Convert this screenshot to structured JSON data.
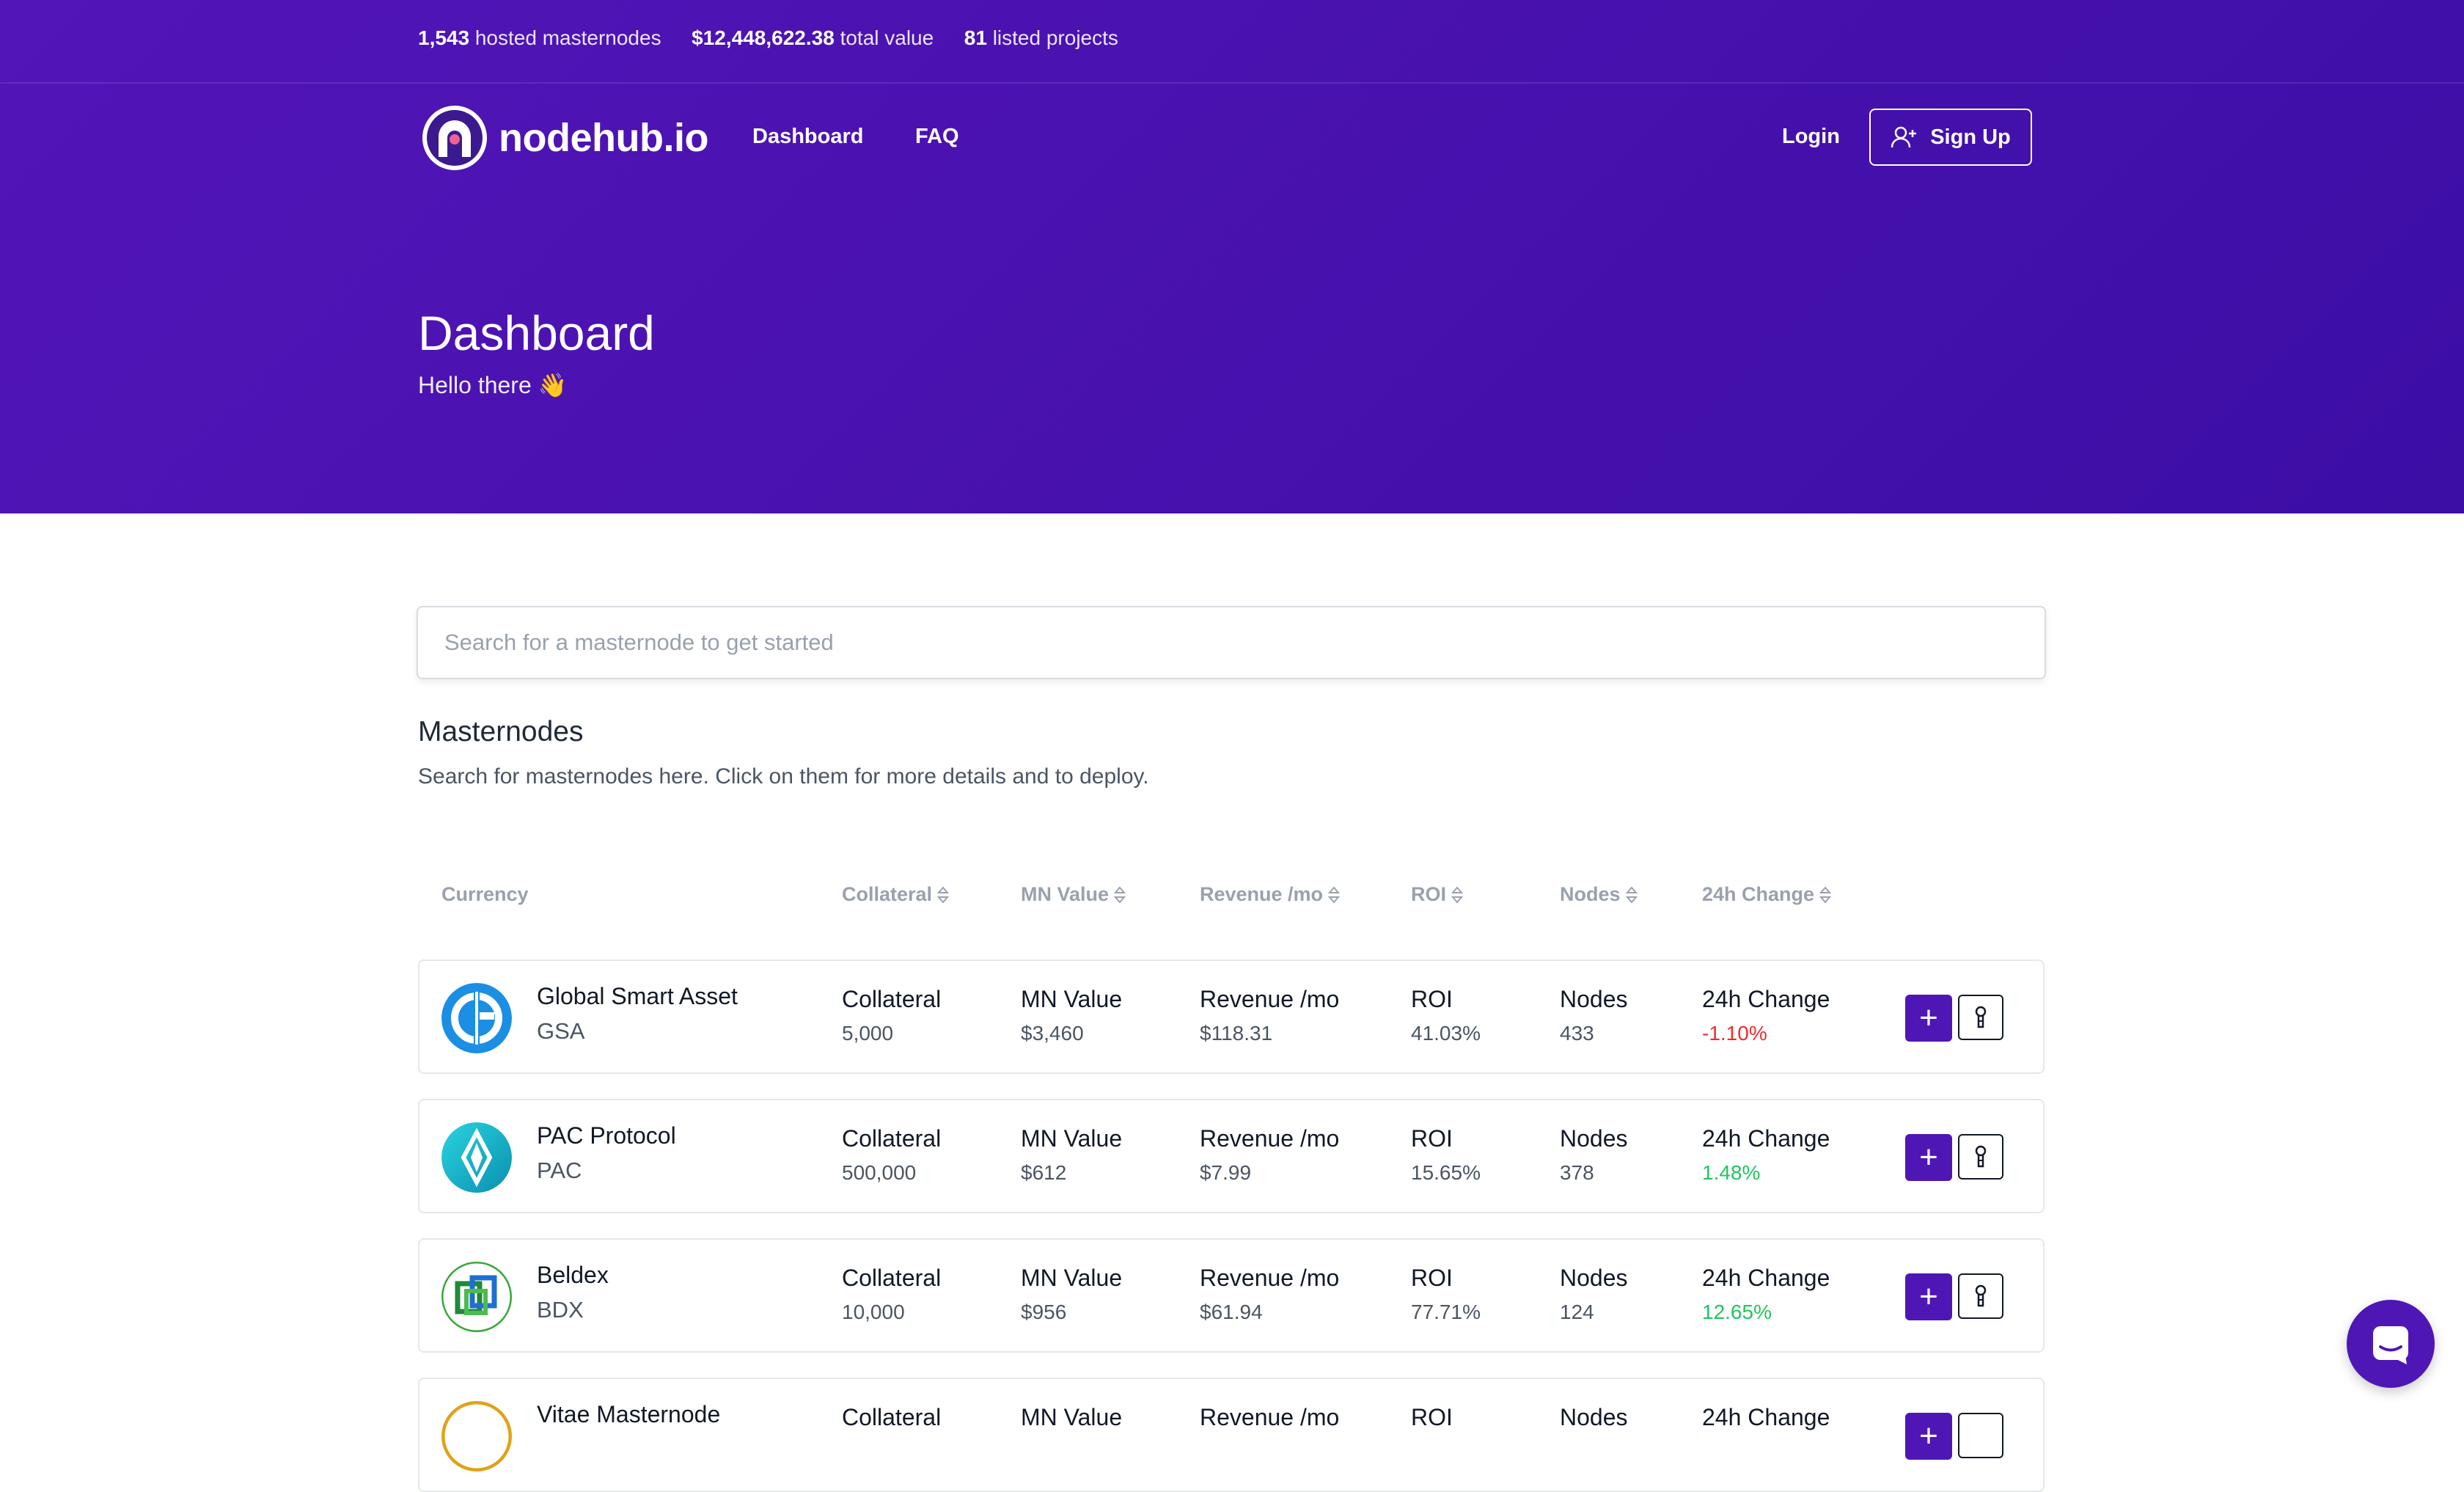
{
  "stats": {
    "masternodes_count": "1,543",
    "masternodes_label": "hosted masternodes",
    "total_value": "$12,448,622.38",
    "total_value_label": "total value",
    "projects_count": "81",
    "projects_label": "listed projects"
  },
  "nav": {
    "brand": "nodehub.io",
    "links": [
      "Dashboard",
      "FAQ"
    ],
    "login": "Login",
    "signup": "Sign Up"
  },
  "hero": {
    "title": "Dashboard",
    "subtitle": "Hello there 👋"
  },
  "search": {
    "placeholder": "Search for a masternode to get started"
  },
  "section": {
    "title": "Masternodes",
    "subtitle": "Search for masternodes here. Click on them for more details and to deploy."
  },
  "table": {
    "headers": [
      "Currency",
      "Collateral",
      "MN Value",
      "Revenue /mo",
      "ROI",
      "Nodes",
      "24h Change"
    ],
    "rows": [
      {
        "name": "Global Smart Asset",
        "symbol": "GSA",
        "collateral": "5,000",
        "mn_value": "$3,460",
        "revenue": "$118.31",
        "roi": "41.03%",
        "nodes": "433",
        "change": "-1.10%",
        "change_dir": "neg",
        "icon": "gsa-coin-icon"
      },
      {
        "name": "PAC Protocol",
        "symbol": "PAC",
        "collateral": "500,000",
        "mn_value": "$612",
        "revenue": "$7.99",
        "roi": "15.65%",
        "nodes": "378",
        "change": "1.48%",
        "change_dir": "pos",
        "icon": "pac-coin-icon"
      },
      {
        "name": "Beldex",
        "symbol": "BDX",
        "collateral": "10,000",
        "mn_value": "$956",
        "revenue": "$61.94",
        "roi": "77.71%",
        "nodes": "124",
        "change": "12.65%",
        "change_dir": "pos",
        "icon": "bdx-coin-icon"
      },
      {
        "name": "Vitae Masternode",
        "symbol": "",
        "collateral": "",
        "mn_value": "",
        "revenue": "",
        "roi": "",
        "nodes": "",
        "change": "",
        "change_dir": "pos",
        "icon": "vitae-coin-icon"
      }
    ],
    "col_labels": {
      "collateral": "Collateral",
      "mn_value": "MN Value",
      "revenue": "Revenue /mo",
      "roi": "ROI",
      "nodes": "Nodes",
      "change": "24h Change"
    },
    "add_label": "+"
  },
  "colors": {
    "hero_bg": "#4a12b0",
    "accent": "#4f16b6",
    "negative": "#ef2b2b",
    "positive": "#22c55e"
  }
}
